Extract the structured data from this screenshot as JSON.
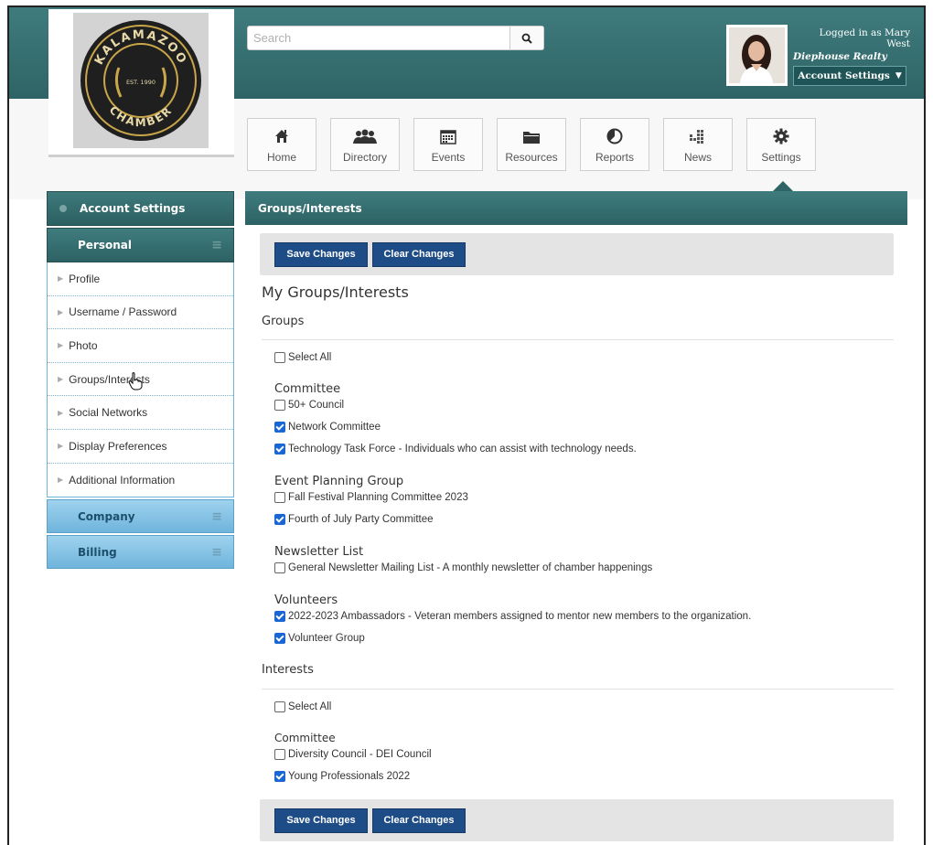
{
  "logo": {
    "org_text_top": "KALAMAZOO",
    "org_text_bottom": "CHAMBER",
    "est": "EST. 1990"
  },
  "search": {
    "placeholder": "Search"
  },
  "user": {
    "logged_in": "Logged in as Mary West",
    "company": "Diephouse Realty",
    "account_button": "Account Settings"
  },
  "nav": {
    "items": [
      {
        "label": "Home",
        "icon": "home-icon"
      },
      {
        "label": "Directory",
        "icon": "directory-icon"
      },
      {
        "label": "Events",
        "icon": "calendar-icon"
      },
      {
        "label": "Resources",
        "icon": "folder-icon"
      },
      {
        "label": "Reports",
        "icon": "chart-icon"
      },
      {
        "label": "News",
        "icon": "news-icon"
      },
      {
        "label": "Settings",
        "icon": "gear-icon"
      }
    ],
    "active": "Settings"
  },
  "sidebar": {
    "header": "Account Settings",
    "personal": "Personal",
    "links": [
      "Profile",
      "Username / Password",
      "Photo",
      "Groups/Interests",
      "Social Networks",
      "Display Preferences",
      "Additional Information"
    ],
    "company": "Company",
    "billing": "Billing"
  },
  "main": {
    "title": "Groups/Interests",
    "save": "Save Changes",
    "clear": "Clear Changes",
    "heading": "My Groups/Interests",
    "groups_label": "Groups",
    "select_all": "Select All",
    "groups": [
      {
        "category": "Committee",
        "items": [
          {
            "label": "50+ Council",
            "checked": false
          },
          {
            "label": "Network Committee",
            "checked": true
          },
          {
            "label": "Technology Task Force - Individuals who can assist with technology needs.",
            "checked": true
          }
        ]
      },
      {
        "category": "Event Planning Group",
        "items": [
          {
            "label": "Fall Festival Planning Committee 2023",
            "checked": false
          },
          {
            "label": "Fourth of July Party Committee",
            "checked": true
          }
        ]
      },
      {
        "category": "Newsletter List",
        "items": [
          {
            "label": "General Newsletter Mailing List - A monthly newsletter of chamber happenings",
            "checked": false
          }
        ]
      },
      {
        "category": "Volunteers",
        "items": [
          {
            "label": "2022-2023 Ambassadors - Veteran members assigned to mentor new members to the organization.",
            "checked": true
          },
          {
            "label": "Volunteer Group",
            "checked": true
          }
        ]
      }
    ],
    "interests_label": "Interests",
    "interests": [
      {
        "category": "Committee",
        "items": [
          {
            "label": "Diversity Council - DEI Council",
            "checked": false
          },
          {
            "label": "Young Professionals 2022",
            "checked": true
          }
        ]
      }
    ]
  },
  "colors": {
    "header_teal": "#2f6466",
    "button_blue": "#1e4c86",
    "sidebar_light_blue": "#6fb4dc",
    "checkbox_blue": "#1a66d2"
  }
}
